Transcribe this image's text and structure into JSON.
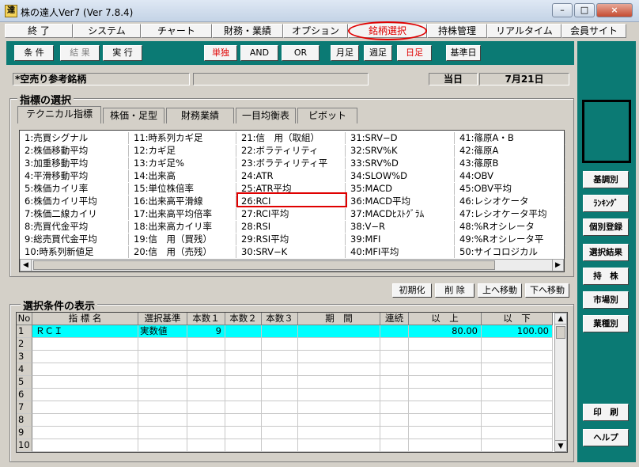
{
  "window": {
    "title": "株の達人Ver7 (Ver 7.8.4)",
    "app_icon": "達",
    "min": "–",
    "max": "□",
    "close": "×"
  },
  "menu": [
    "終 了",
    "システム",
    "チャート",
    "財務・業績",
    "オプション",
    "銘柄選択",
    "持株管理",
    "リアルタイム",
    "会員サイト"
  ],
  "toolbar": {
    "b1": "条 件",
    "b2": "結 果",
    "b3": "実 行",
    "single": "単独",
    "and": "AND",
    "or": "OR",
    "monthly": "月足",
    "weekly": "週足",
    "daily": "日足",
    "base_date": "基準日"
  },
  "info": {
    "name": "*空売り参考銘柄",
    "date_label": "当日",
    "date_value": "7月21日"
  },
  "indicator_group": {
    "title": "指標の選択",
    "tabs": [
      "テクニカル指標",
      "株価・足型",
      "財務業績",
      "一目均衡表",
      "ピボット"
    ],
    "columns": [
      [
        "1:売買シグナル",
        "2:株価移動平均",
        "3:加重移動平均",
        "4:平滑移動平均",
        "5:株価カイリ率",
        "6:株価カイリ平均",
        "7:株価二線カイリ",
        "8:売買代金平均",
        "9:総売買代金平均",
        "10:時系列新値足"
      ],
      [
        "11:時系列カギ足",
        "12:カギ足",
        "13:カギ足%",
        "14:出来高",
        "15:単位株倍率",
        "16:出来高平滑線",
        "17:出来高平均倍率",
        "18:出来高カイリ率",
        "19:信　用（買残）",
        "20:信　用（売残）"
      ],
      [
        "21:信　用（取組）",
        "22:ボラティリティ",
        "23:ボラティリティ平",
        "24:ATR",
        "25:ATR平均",
        "26:RCI",
        "27:RCI平均",
        "28:RSI",
        "29:RSI平均",
        "30:SRV−K"
      ],
      [
        "31:SRV−D",
        "32:SRV%K",
        "33:SRV%D",
        "34:SLOW%D",
        "35:MACD",
        "36:MACD平均",
        "37:MACDﾋｽﾄｸﾞﾗﾑ",
        "38:V−R",
        "39:MFI",
        "40:MFI平均"
      ],
      [
        "41:篠原A・B",
        "42:篠原A",
        "43:篠原B",
        "44:OBV",
        "45:OBV平均",
        "46:レシオケータ",
        "47:レシオケータ平均",
        "48:%Rオシレータ",
        "49:%Rオシレータ平",
        "50:サイコロジカル"
      ]
    ]
  },
  "list_buttons": {
    "init": "初期化",
    "delete": "削 除",
    "up": "上へ移動",
    "down": "下へ移動"
  },
  "conditions": {
    "title": "選択条件の表示",
    "headers": [
      "No",
      "指 標 名",
      "選択基準",
      "本数１",
      "本数２",
      "本数３",
      "期　間",
      "連続",
      "以　上",
      "以　下"
    ],
    "row1": {
      "no": "1",
      "name": "ＲＣＩ",
      "criterion": "実数値",
      "n1": "9",
      "above": "80.00",
      "below": "100.00"
    },
    "row_numbers": [
      "2",
      "3",
      "4",
      "5",
      "6",
      "7",
      "8",
      "9",
      "10"
    ]
  },
  "right_buttons": [
    "基調別",
    "ﾗﾝｷﾝｸﾞ",
    "個別登録",
    "選択結果",
    "持　株",
    "市場別",
    "業種別",
    "印　刷",
    "ヘルプ"
  ],
  "colors": {
    "teal": "#0b7a74",
    "selected_row": "#00ffff",
    "highlight": "#e00000"
  }
}
